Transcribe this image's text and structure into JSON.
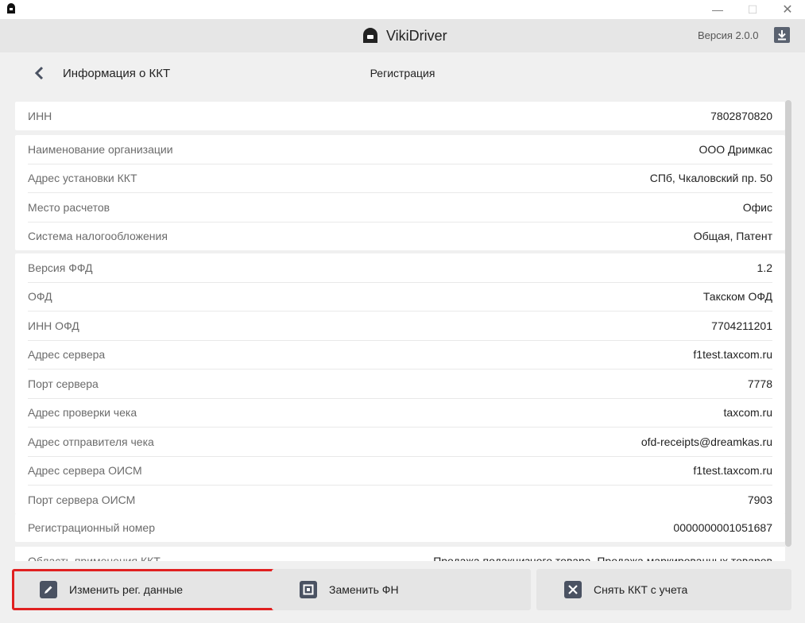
{
  "app": {
    "title": "VikiDriver",
    "version": "Версия 2.0.0"
  },
  "nav": {
    "back_label": "Информация о ККТ",
    "page_title": "Регистрация"
  },
  "sections": [
    [
      {
        "label": "ИНН",
        "value": "7802870820"
      }
    ],
    [
      {
        "label": "Наименование организации",
        "value": "ООО Дримкас"
      },
      {
        "label": "Адрес установки ККТ",
        "value": "СПб, Чкаловский пр. 50"
      },
      {
        "label": "Место расчетов",
        "value": "Офис"
      },
      {
        "label": "Система налогообложения",
        "value": "Общая, Патент"
      }
    ],
    [
      {
        "label": "Версия ФФД",
        "value": "1.2"
      },
      {
        "label": "ОФД",
        "value": "Такском ОФД"
      },
      {
        "label": "ИНН ОФД",
        "value": "7704211201"
      },
      {
        "label": "Адрес сервера",
        "value": "f1test.taxcom.ru"
      },
      {
        "label": "Порт сервера",
        "value": "7778"
      },
      {
        "label": "Адрес проверки чека",
        "value": "taxcom.ru"
      },
      {
        "label": "Адрес отправителя чека",
        "value": "ofd-receipts@dreamkas.ru"
      },
      {
        "label": "Адрес сервера ОИСМ",
        "value": "f1test.taxcom.ru"
      },
      {
        "label": "Порт сервера ОИСМ",
        "value": "7903"
      }
    ],
    [
      {
        "label": "Регистрационный номер",
        "value": "0000000001051687"
      }
    ]
  ],
  "partial_row": {
    "label": "Область применения ККТ",
    "value": "Продажа подакцизного товара, Продажа маркированных товаров"
  },
  "actions": {
    "edit": "Изменить рег. данные",
    "replace_fn": "Заменить ФН",
    "deregister": "Снять ККТ с учета"
  }
}
